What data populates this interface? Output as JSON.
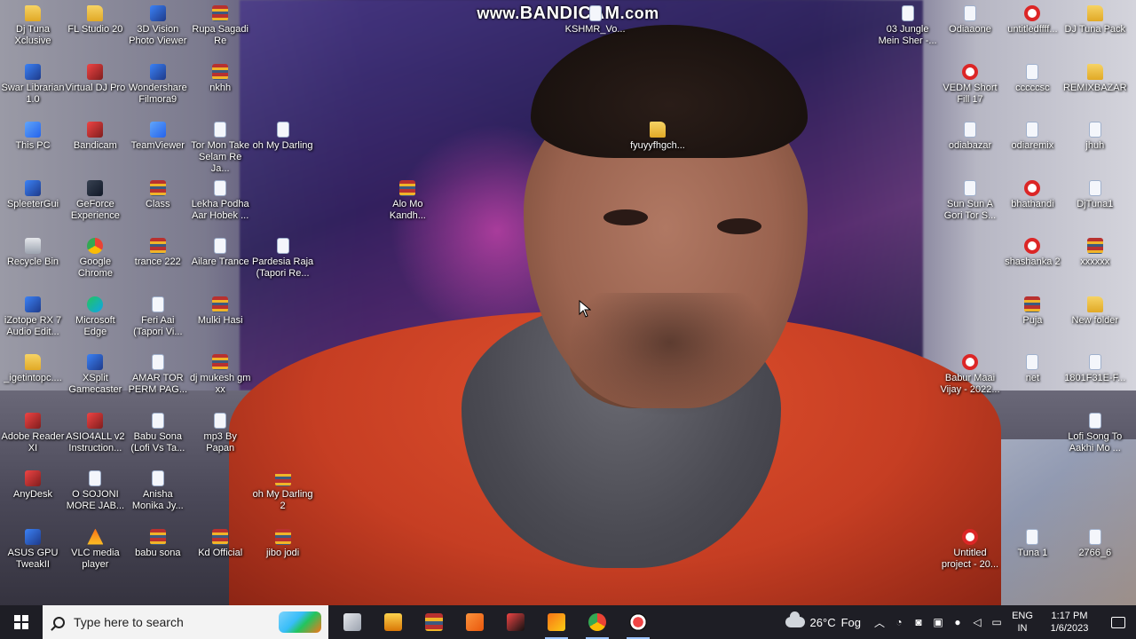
{
  "watermark": {
    "prefix": "www.",
    "brand": "BANDICAM",
    "suffix": ".com"
  },
  "desktop_icons": [
    {
      "id": "dj-tuna-xclusive",
      "label": "Dj Tuna Xclusive",
      "icon": "folder-icon",
      "col": 0,
      "row": 0
    },
    {
      "id": "swar-librarian",
      "label": "Swar Librarian 1.0",
      "icon": "app-icon",
      "col": 0,
      "row": 1
    },
    {
      "id": "this-pc",
      "label": "This PC",
      "icon": "computer-icon",
      "col": 0,
      "row": 2
    },
    {
      "id": "spleetergui",
      "label": "SpleeterGui",
      "icon": "app-icon",
      "col": 0,
      "row": 3
    },
    {
      "id": "recycle-bin",
      "label": "Recycle Bin",
      "icon": "recycle-bin-icon",
      "col": 0,
      "row": 4
    },
    {
      "id": "izotope-rx7",
      "label": "iZotope RX 7 Audio Edit...",
      "icon": "app-icon",
      "col": 0,
      "row": 5
    },
    {
      "id": "igetintopc",
      "label": "_igetintopc....",
      "icon": "folder-icon",
      "col": 0,
      "row": 6
    },
    {
      "id": "adobe-reader",
      "label": "Adobe Reader XI",
      "icon": "pdf-icon",
      "col": 0,
      "row": 7
    },
    {
      "id": "anydesk",
      "label": "AnyDesk",
      "icon": "anydesk-icon",
      "col": 0,
      "row": 8
    },
    {
      "id": "asus-gpu-tweak",
      "label": "ASUS GPU TweakII",
      "icon": "app-icon",
      "col": 0,
      "row": 9
    },
    {
      "id": "fl-studio",
      "label": "FL Studio 20",
      "icon": "fl-studio-icon",
      "col": 1,
      "row": 0
    },
    {
      "id": "virtual-dj",
      "label": "Virtual DJ Pro",
      "icon": "virtual-dj-icon",
      "col": 1,
      "row": 1
    },
    {
      "id": "bandicam",
      "label": "Bandicam",
      "icon": "bandicam-icon",
      "col": 1,
      "row": 2
    },
    {
      "id": "geforce",
      "label": "GeForce Experience",
      "icon": "geforce-icon",
      "col": 1,
      "row": 3
    },
    {
      "id": "google-chrome",
      "label": "Google Chrome",
      "icon": "chrome-icon",
      "col": 1,
      "row": 4
    },
    {
      "id": "microsoft-edge",
      "label": "Microsoft Edge",
      "icon": "edge-icon",
      "col": 1,
      "row": 5
    },
    {
      "id": "xsplit",
      "label": "XSplit Gamecaster",
      "icon": "app-icon",
      "col": 1,
      "row": 6
    },
    {
      "id": "asio4all",
      "label": "ASIO4ALL v2 Instruction...",
      "icon": "pdf-icon",
      "col": 1,
      "row": 7
    },
    {
      "id": "o-sojoni",
      "label": "O SOJONI MORE JAB...",
      "icon": "file-icon",
      "col": 1,
      "row": 8
    },
    {
      "id": "vlc",
      "label": "VLC media player",
      "icon": "vlc-icon",
      "col": 1,
      "row": 9
    },
    {
      "id": "3d-vision",
      "label": "3D Vision Photo Viewer",
      "icon": "app-icon",
      "col": 2,
      "row": 0
    },
    {
      "id": "filmora",
      "label": "Wondershare Filmora9",
      "icon": "app-icon",
      "col": 2,
      "row": 1
    },
    {
      "id": "teamviewer",
      "label": "TeamViewer",
      "icon": "teamviewer-icon",
      "col": 2,
      "row": 2
    },
    {
      "id": "class",
      "label": "Class",
      "icon": "archive-icon",
      "col": 2,
      "row": 3
    },
    {
      "id": "trance-222",
      "label": "trance 222",
      "icon": "archive-icon",
      "col": 2,
      "row": 4
    },
    {
      "id": "feri-aai",
      "label": "Feri Aai (Tapori Vi...",
      "icon": "file-icon",
      "col": 2,
      "row": 5
    },
    {
      "id": "amar-tor",
      "label": "AMAR TOR PERM PAG...",
      "icon": "file-icon",
      "col": 2,
      "row": 6
    },
    {
      "id": "babu-sona-lofi",
      "label": "Babu Sona (Lofi Vs Ta...",
      "icon": "file-icon",
      "col": 2,
      "row": 7
    },
    {
      "id": "anisha-monika",
      "label": "Anisha Monika Jy...",
      "icon": "file-icon",
      "col": 2,
      "row": 8
    },
    {
      "id": "babu-sona",
      "label": "babu sona",
      "icon": "archive-icon",
      "col": 2,
      "row": 9
    },
    {
      "id": "rupa-sagadi",
      "label": "Rupa Sagadi Re",
      "icon": "archive-icon",
      "col": 3,
      "row": 0
    },
    {
      "id": "nkhh",
      "label": "nkhh",
      "icon": "archive-icon",
      "col": 3,
      "row": 1
    },
    {
      "id": "tor-mon-take",
      "label": "Tor Mon Take Selam Re Ja...",
      "icon": "file-icon",
      "col": 3,
      "row": 2
    },
    {
      "id": "lekha-podha",
      "label": "Lekha Podha Aar Hobek ...",
      "icon": "file-icon",
      "col": 3,
      "row": 3
    },
    {
      "id": "ailare-trance",
      "label": "Ailare Trance",
      "icon": "file-icon",
      "col": 3,
      "row": 4
    },
    {
      "id": "mulki-hasi",
      "label": "Mulki Hasi",
      "icon": "archive-icon",
      "col": 3,
      "row": 5
    },
    {
      "id": "dj-mukesh",
      "label": "dj mukesh gm xx",
      "icon": "archive-icon",
      "col": 3,
      "row": 6
    },
    {
      "id": "mp3-by-papan",
      "label": "mp3 By Papan",
      "icon": "file-icon",
      "col": 3,
      "row": 7
    },
    {
      "id": "kd-official",
      "label": "Kd Official",
      "icon": "archive-icon",
      "col": 3,
      "row": 9
    },
    {
      "id": "oh-my-darling",
      "label": "oh My Darling",
      "icon": "file-icon",
      "col": 4,
      "row": 2
    },
    {
      "id": "pardesia-raja",
      "label": "Pardesia Raja (Tapori Re...",
      "icon": "file-icon",
      "col": 4,
      "row": 4
    },
    {
      "id": "oh-my-darling-2",
      "label": "oh My Darling 2",
      "icon": "archive-icon",
      "col": 4,
      "row": 8
    },
    {
      "id": "jibo-jodi",
      "label": "jibo jodi",
      "icon": "archive-icon",
      "col": 4,
      "row": 9
    },
    {
      "id": "alo-mo-kandh",
      "label": "Alo Mo Kandh...",
      "icon": "archive-icon",
      "col": 6,
      "row": 3
    },
    {
      "id": "kshmr-vo",
      "label": "KSHMR_Vo...",
      "icon": "file-icon",
      "col": 9,
      "row": 0
    },
    {
      "id": "fyuyyfhgch",
      "label": "fyuyyfhgch...",
      "icon": "folder-icon",
      "col": 10,
      "row": 2
    },
    {
      "id": "03-jungle",
      "label": "03 Jungle Mein Sher -...",
      "icon": "file-icon",
      "col": 14,
      "row": 0
    },
    {
      "id": "odiaaone",
      "label": "Odiaaone",
      "icon": "file-icon",
      "col": 15,
      "row": 0
    },
    {
      "id": "vedm-short",
      "label": "VEDM Short Fill 17",
      "icon": "media-icon",
      "col": 15,
      "row": 1
    },
    {
      "id": "odiabazar",
      "label": "odiabazar",
      "icon": "file-icon",
      "col": 15,
      "row": 2
    },
    {
      "id": "sun-sun-a-gori",
      "label": "Sun Sun A Gori Tor S...",
      "icon": "file-icon",
      "col": 15,
      "row": 3
    },
    {
      "id": "babur-maai",
      "label": "Babur Maai Vijay - 2022...",
      "icon": "media-icon",
      "col": 15,
      "row": 6
    },
    {
      "id": "untitled-project",
      "label": "Untitled project - 20...",
      "icon": "media-icon",
      "col": 15,
      "row": 9
    },
    {
      "id": "untitledffff",
      "label": "untitledffff...",
      "icon": "media-icon",
      "col": 16,
      "row": 0
    },
    {
      "id": "cccccsc",
      "label": "cccccsc",
      "icon": "file-icon",
      "col": 16,
      "row": 1
    },
    {
      "id": "odiaremix",
      "label": "odiaremix",
      "icon": "file-icon",
      "col": 16,
      "row": 2
    },
    {
      "id": "bhathandi",
      "label": "bhathandi",
      "icon": "media-icon",
      "col": 16,
      "row": 3
    },
    {
      "id": "shashanka-2",
      "label": "shashanka 2",
      "icon": "media-icon",
      "col": 16,
      "row": 4
    },
    {
      "id": "puja",
      "label": "Puja",
      "icon": "archive-icon",
      "col": 16,
      "row": 5
    },
    {
      "id": "net",
      "label": "net",
      "icon": "file-icon",
      "col": 16,
      "row": 6
    },
    {
      "id": "tuna-1",
      "label": "Tuna 1",
      "icon": "file-icon",
      "col": 16,
      "row": 9
    },
    {
      "id": "dj-tuna-pack",
      "label": "DJ Tuna Pack",
      "icon": "folder-icon",
      "col": 17,
      "row": 0
    },
    {
      "id": "remixbazar",
      "label": "REMIXBAZAR",
      "icon": "folder-icon",
      "col": 17,
      "row": 1
    },
    {
      "id": "jhuh",
      "label": "jhuh",
      "icon": "file-icon",
      "col": 17,
      "row": 2
    },
    {
      "id": "djtuna1",
      "label": "DjTuna1",
      "icon": "file-icon",
      "col": 17,
      "row": 3
    },
    {
      "id": "xxxxxx",
      "label": "xxxxxx",
      "icon": "archive-icon",
      "col": 17,
      "row": 4
    },
    {
      "id": "new-folder",
      "label": "New folder",
      "icon": "folder-icon",
      "col": 17,
      "row": 5
    },
    {
      "id": "1801f31e",
      "label": "1801F31E-F...",
      "icon": "file-icon",
      "col": 17,
      "row": 6
    },
    {
      "id": "lofi-song",
      "label": "Lofi Song To Aakhi Mo ...",
      "icon": "file-icon",
      "col": 17,
      "row": 7
    },
    {
      "id": "2766-6",
      "label": "2766_6",
      "icon": "file-icon",
      "col": 17,
      "row": 9
    }
  ],
  "taskbar": {
    "search_placeholder": "Type here to search",
    "apps": [
      {
        "name": "task-view-icon",
        "active": false
      },
      {
        "name": "file-explorer-icon",
        "active": false
      },
      {
        "name": "winrar-icon",
        "active": false
      },
      {
        "name": "video-player-icon",
        "active": false
      },
      {
        "name": "virtual-dj-icon",
        "active": false
      },
      {
        "name": "fl-studio-icon",
        "active": true
      },
      {
        "name": "chrome-icon",
        "active": true
      },
      {
        "name": "bandicam-record-icon",
        "active": true
      }
    ],
    "weather": {
      "temp": "26°C",
      "condition": "Fog"
    },
    "language": {
      "line1": "ENG",
      "line2": "IN"
    },
    "clock": {
      "time": "1:17 PM",
      "date": "1/6/2023"
    }
  }
}
